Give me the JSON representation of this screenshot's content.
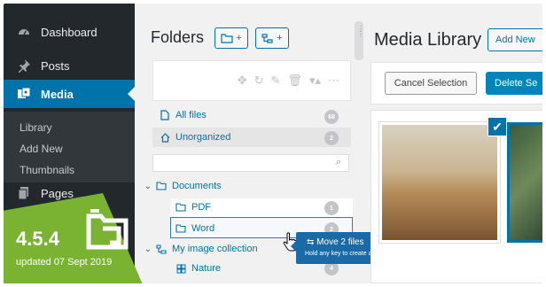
{
  "sidebar": {
    "items": [
      {
        "label": "Dashboard",
        "icon": "dashboard-icon"
      },
      {
        "label": "Posts",
        "icon": "pin-icon"
      },
      {
        "label": "Media",
        "icon": "media-icon"
      },
      {
        "label": "Pages",
        "icon": "pages-icon"
      }
    ],
    "submenu": [
      "Library",
      "Add New",
      "Thumbnails"
    ]
  },
  "badge": {
    "version": "4.5.4",
    "updated": "updated 07 Sept 2019"
  },
  "folders": {
    "title": "Folders",
    "add_folder_button": "+",
    "add_category_button": "+",
    "all_files": {
      "label": "All files",
      "count": "68"
    },
    "unorganized": {
      "label": "Unorganized",
      "count": "2"
    },
    "search_placeholder": "",
    "tree": [
      {
        "label": "Documents"
      },
      {
        "label": "PDF",
        "count": "1"
      },
      {
        "label": "Word",
        "count": "2"
      },
      {
        "label": "My image collection"
      },
      {
        "label": "Nature",
        "count": "4"
      }
    ]
  },
  "drag_tooltip": {
    "main": "Move 2 files",
    "hint": "Hold any key to create a shortcut"
  },
  "media_library": {
    "title": "Media Library",
    "add_new": "Add New",
    "cancel_selection": "Cancel Selection",
    "delete_selected": "Delete Se"
  },
  "colors": {
    "wp_blue": "#0073aa",
    "sidebar_bg": "#23282d",
    "badge_green": "#7ab332"
  }
}
